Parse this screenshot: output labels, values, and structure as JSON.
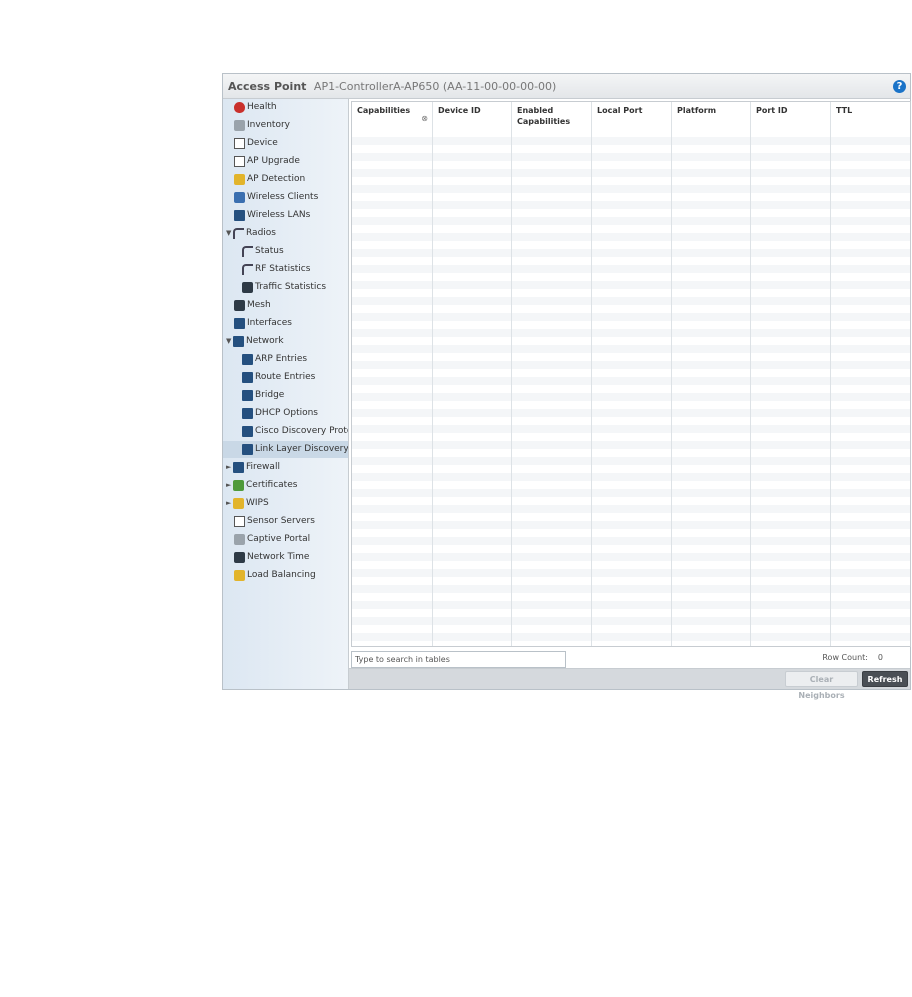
{
  "header": {
    "title": "Access Point",
    "subtitle": "AP1-ControllerA-AP650 (AA-11-00-00-00-00)",
    "help_label": "?"
  },
  "sidebar": {
    "items": [
      {
        "label": "Health",
        "icon": "heart-icon"
      },
      {
        "label": "Inventory",
        "icon": "inventory-icon"
      },
      {
        "label": "Device",
        "icon": "device-icon"
      },
      {
        "label": "AP Upgrade",
        "icon": "upgrade-icon"
      },
      {
        "label": "AP Detection",
        "icon": "detection-icon"
      },
      {
        "label": "Wireless Clients",
        "icon": "clients-icon"
      },
      {
        "label": "Wireless LANs",
        "icon": "wlan-icon"
      },
      {
        "label": "Radios",
        "icon": "radio-antenna-icon",
        "expanded": true
      },
      {
        "label": "Status",
        "icon": "radio-antenna-icon"
      },
      {
        "label": "RF Statistics",
        "icon": "radio-antenna-icon"
      },
      {
        "label": "Traffic Statistics",
        "icon": "traffic-icon"
      },
      {
        "label": "Mesh",
        "icon": "mesh-icon"
      },
      {
        "label": "Interfaces",
        "icon": "interfaces-icon"
      },
      {
        "label": "Network",
        "icon": "network-icon",
        "expanded": true
      },
      {
        "label": "ARP Entries",
        "icon": "arp-icon"
      },
      {
        "label": "Route Entries",
        "icon": "route-icon"
      },
      {
        "label": "Bridge",
        "icon": "bridge-icon"
      },
      {
        "label": "DHCP Options",
        "icon": "dhcp-icon"
      },
      {
        "label": "Cisco Discovery Protoco",
        "icon": "cdp-icon"
      },
      {
        "label": "Link Layer Discovery Pr",
        "icon": "lldp-icon",
        "selected": true
      },
      {
        "label": "Firewall",
        "icon": "firewall-icon",
        "collapsed": true
      },
      {
        "label": "Certificates",
        "icon": "certificates-icon",
        "collapsed": true
      },
      {
        "label": "WIPS",
        "icon": "wips-icon",
        "collapsed": true
      },
      {
        "label": "Sensor Servers",
        "icon": "sensor-icon"
      },
      {
        "label": "Captive Portal",
        "icon": "portal-icon"
      },
      {
        "label": "Network Time",
        "icon": "time-icon"
      },
      {
        "label": "Load Balancing",
        "icon": "balance-icon"
      }
    ]
  },
  "table": {
    "columns": [
      "Capabilities",
      "Device ID",
      "Enabled Capabilities",
      "Local Port",
      "Platform",
      "Port ID",
      "TTL"
    ],
    "rows": []
  },
  "search": {
    "placeholder": "Type to search in tables"
  },
  "row_count": {
    "label": "Row Count:",
    "value": "0"
  },
  "buttons": {
    "clear": "Clear Neighbors",
    "refresh": "Refresh"
  },
  "colors": {
    "selected_nav": "#c9d8e6",
    "sidebar_bg": "#dce7f2",
    "refresh_btn": "#4a4f55",
    "help": "#1a73c8"
  }
}
